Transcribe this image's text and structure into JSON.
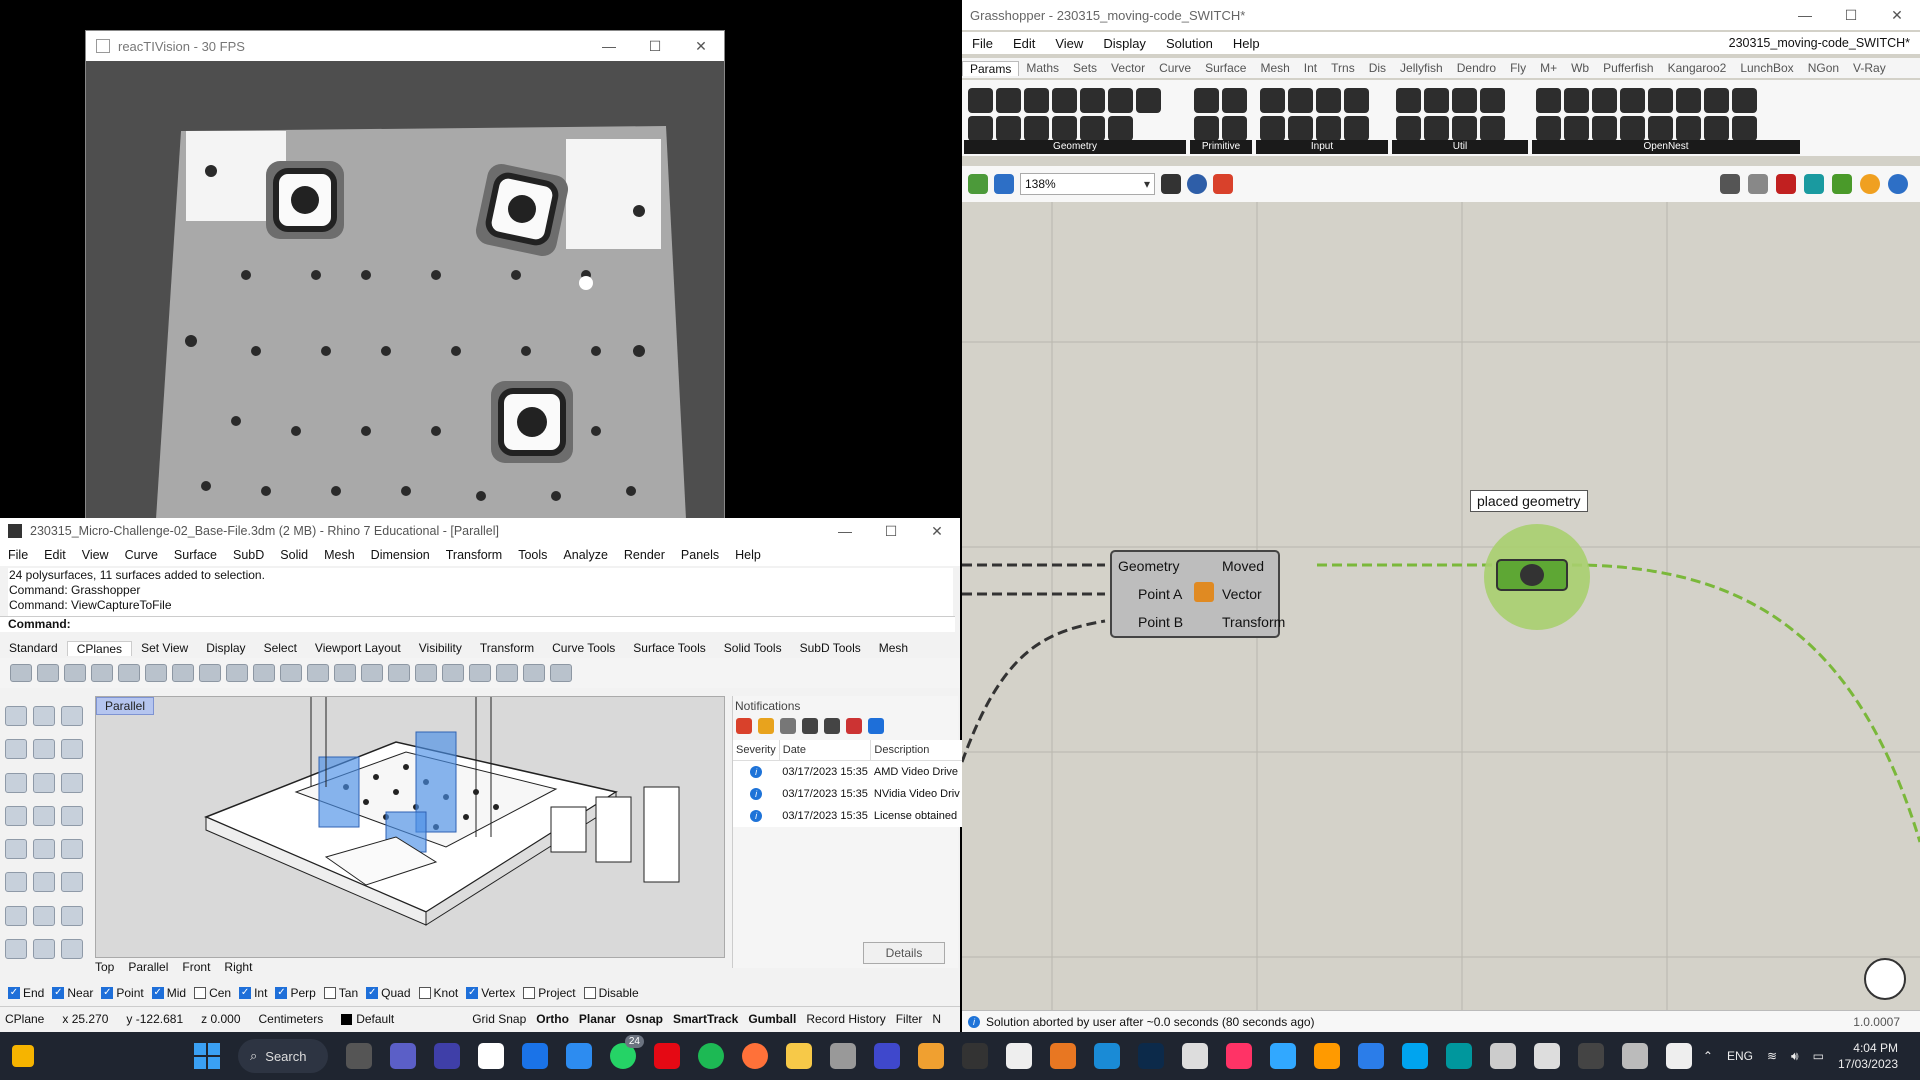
{
  "reactivision": {
    "title": "reacTIVision - 30 FPS"
  },
  "rhino": {
    "title": "230315_Micro-Challenge-02_Base-File.3dm (2 MB) - Rhino 7 Educational - [Parallel]",
    "menu": [
      "File",
      "Edit",
      "View",
      "Curve",
      "Surface",
      "SubD",
      "Solid",
      "Mesh",
      "Dimension",
      "Transform",
      "Tools",
      "Analyze",
      "Render",
      "Panels",
      "Help"
    ],
    "history": [
      "24 polysurfaces, 11 surfaces added to selection.",
      "Command: Grasshopper",
      "Command: ViewCaptureToFile"
    ],
    "command_label": "Command:",
    "tabs": [
      "Standard",
      "CPlanes",
      "Set View",
      "Display",
      "Select",
      "Viewport Layout",
      "Visibility",
      "Transform",
      "Curve Tools",
      "Surface Tools",
      "Solid Tools",
      "SubD Tools",
      "Mesh"
    ],
    "viewport_label": "Parallel",
    "viewport_tabs": [
      "Top",
      "Parallel",
      "Front",
      "Right"
    ],
    "notifications": {
      "header": "Notifications",
      "cols": [
        "Severity",
        "Date",
        "Description"
      ],
      "rows": [
        {
          "date": "03/17/2023 15:35",
          "desc": "AMD Video Drive"
        },
        {
          "date": "03/17/2023 15:35",
          "desc": "NVidia Video Driv"
        },
        {
          "date": "03/17/2023 15:35",
          "desc": "License obtained"
        }
      ],
      "details": "Details"
    },
    "osnaps": [
      {
        "label": "End",
        "on": true
      },
      {
        "label": "Near",
        "on": true
      },
      {
        "label": "Point",
        "on": true
      },
      {
        "label": "Mid",
        "on": true
      },
      {
        "label": "Cen",
        "on": false
      },
      {
        "label": "Int",
        "on": true
      },
      {
        "label": "Perp",
        "on": true
      },
      {
        "label": "Tan",
        "on": false
      },
      {
        "label": "Quad",
        "on": true
      },
      {
        "label": "Knot",
        "on": false
      },
      {
        "label": "Vertex",
        "on": true
      },
      {
        "label": "Project",
        "on": false
      },
      {
        "label": "Disable",
        "on": false
      }
    ],
    "status": {
      "cplane": "CPlane",
      "x": "x 25.270",
      "y": "y -122.681",
      "z": "z 0.000",
      "units": "Centimeters",
      "layer": "Default",
      "toggles": [
        "Grid Snap",
        "Ortho",
        "Planar",
        "Osnap",
        "SmartTrack",
        "Gumball",
        "Record History",
        "Filter",
        "N"
      ]
    }
  },
  "gh": {
    "title": "Grasshopper - 230315_moving-code_SWITCH*",
    "menu": [
      "File",
      "Edit",
      "View",
      "Display",
      "Solution",
      "Help"
    ],
    "doc": "230315_moving-code_SWITCH*",
    "tabs": [
      "Params",
      "Maths",
      "Sets",
      "Vector",
      "Curve",
      "Surface",
      "Mesh",
      "Int",
      "Trns",
      "Dis",
      "Jellyfish",
      "Dendro",
      "Fly",
      "M+",
      "Wb",
      "Pufferfish",
      "Kangaroo2",
      "LunchBox",
      "NGon",
      "V-Ray"
    ],
    "groups": [
      "Geometry",
      "Primitive",
      "Input",
      "Util",
      "OpenNest"
    ],
    "zoom": "138%",
    "move": {
      "inputs": [
        "Geometry",
        "Point A",
        "Point B"
      ],
      "outputs": [
        "Moved",
        "Vector",
        "Transform"
      ]
    },
    "tooltip": "placed geometry",
    "status": "Solution aborted by user after ~0.0 seconds (80 seconds ago)",
    "version": "1.0.0007"
  },
  "taskbar": {
    "search": "Search",
    "badge": "24",
    "lang": "ENG",
    "time": "4:04 PM",
    "date": "17/03/2023"
  },
  "colors": {
    "gh_canvas": "#d4d2c9",
    "wire": "#7ab83a",
    "param": "#a9cf6f"
  }
}
